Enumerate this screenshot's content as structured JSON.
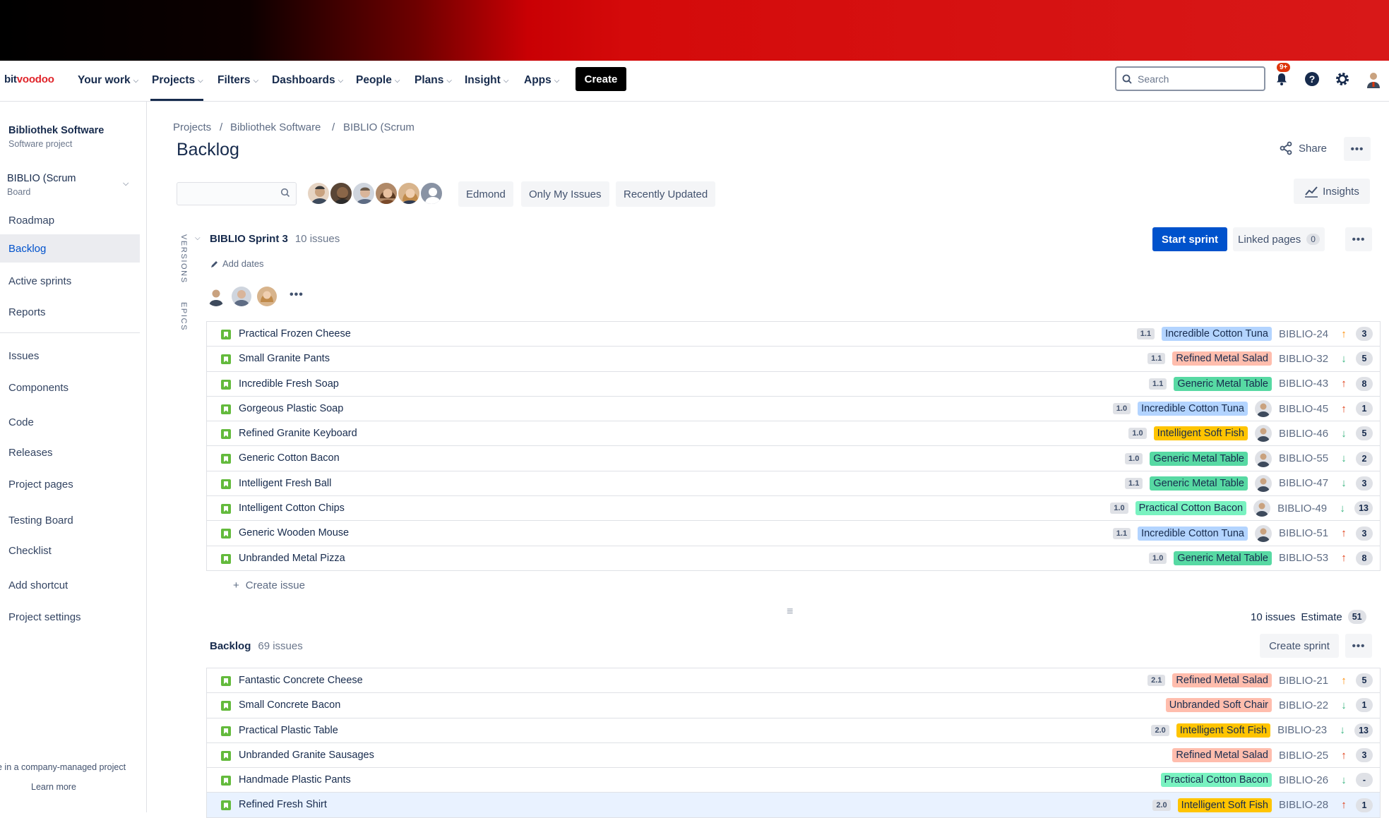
{
  "topnav": {
    "logo_a": "bit",
    "logo_b": "voodoo",
    "items": [
      {
        "label": "Your work"
      },
      {
        "label": "Projects"
      },
      {
        "label": "Filters"
      },
      {
        "label": "Dashboards"
      },
      {
        "label": "People"
      },
      {
        "label": "Plans"
      },
      {
        "label": "Insight"
      },
      {
        "label": "Apps"
      }
    ],
    "active": "Projects",
    "create": "Create",
    "search_placeholder": "Search",
    "notif_badge": "9+",
    "accent": "#0052cc"
  },
  "sidebar": {
    "project_name": "Bibliothek Software",
    "project_type": "Software project",
    "board_name": "BIBLIO (Scrum",
    "board_type": "Board",
    "items": [
      {
        "label": "Roadmap"
      },
      {
        "label": "Backlog"
      },
      {
        "label": "Active sprints"
      },
      {
        "label": "Reports"
      },
      {
        "label": "Issues"
      },
      {
        "label": "Components"
      },
      {
        "label": "Code"
      },
      {
        "label": "Releases"
      },
      {
        "label": "Project pages"
      },
      {
        "label": "Testing Board"
      },
      {
        "label": "Checklist"
      },
      {
        "label": "Add shortcut"
      },
      {
        "label": "Project settings"
      }
    ],
    "active": "Backlog",
    "footer_text": "e in a company-managed project",
    "footer_link": "Learn more"
  },
  "breadcrumb": [
    "Projects",
    "Bibliothek Software",
    "BIBLIO (Scrum"
  ],
  "page_title": "Backlog",
  "share_label": "Share",
  "filters": {
    "edmond": "Edmond",
    "only_my": "Only My Issues",
    "recent": "Recently Updated",
    "insights": "Insights"
  },
  "side_tabs": {
    "versions": "VERSIONS",
    "epics": "EPICS"
  },
  "sprint": {
    "name": "BIBLIO Sprint 3",
    "count": "10 issues",
    "add_dates": "Add dates",
    "start": "Start sprint",
    "linked": "Linked pages",
    "linked_count": "0",
    "issues": [
      {
        "summary": "Practical Frozen Cheese",
        "version": "1.1",
        "epic": "Incredible Cotton Tuna",
        "epic_color": "#b3d4ff",
        "key": "BIBLIO-24",
        "priority": "up-orange",
        "estimate": "3",
        "assignee": false
      },
      {
        "summary": "Small Granite Pants",
        "version": "1.1",
        "epic": "Refined Metal Salad",
        "epic_color": "#ffbdad",
        "key": "BIBLIO-32",
        "priority": "down",
        "estimate": "5",
        "assignee": false
      },
      {
        "summary": "Incredible Fresh Soap",
        "version": "1.1",
        "epic": "Generic Metal Table",
        "epic_color": "#57d9a3",
        "key": "BIBLIO-43",
        "priority": "up-red",
        "estimate": "8",
        "assignee": false
      },
      {
        "summary": "Gorgeous Plastic Soap",
        "version": "1.0",
        "epic": "Incredible Cotton Tuna",
        "epic_color": "#b3d4ff",
        "key": "BIBLIO-45",
        "priority": "up-red",
        "estimate": "1",
        "assignee": true
      },
      {
        "summary": "Refined Granite Keyboard",
        "version": "1.0",
        "epic": "Intelligent Soft Fish",
        "epic_color": "#ffc400",
        "key": "BIBLIO-46",
        "priority": "down",
        "estimate": "5",
        "assignee": true
      },
      {
        "summary": "Generic Cotton Bacon",
        "version": "1.0",
        "epic": "Generic Metal Table",
        "epic_color": "#57d9a3",
        "key": "BIBLIO-55",
        "priority": "down",
        "estimate": "2",
        "assignee": true
      },
      {
        "summary": "Intelligent Fresh Ball",
        "version": "1.1",
        "epic": "Generic Metal Table",
        "epic_color": "#57d9a3",
        "key": "BIBLIO-47",
        "priority": "down",
        "estimate": "3",
        "assignee": true
      },
      {
        "summary": "Intelligent Cotton Chips",
        "version": "1.0",
        "epic": "Practical Cotton Bacon",
        "epic_color": "#79f2c0",
        "key": "BIBLIO-49",
        "priority": "down",
        "estimate": "13",
        "assignee": true
      },
      {
        "summary": "Generic Wooden Mouse",
        "version": "1.1",
        "epic": "Incredible Cotton Tuna",
        "epic_color": "#b3d4ff",
        "key": "BIBLIO-51",
        "priority": "up-red",
        "estimate": "3",
        "assignee": true
      },
      {
        "summary": "Unbranded Metal Pizza",
        "version": "1.0",
        "epic": "Generic Metal Table",
        "epic_color": "#57d9a3",
        "key": "BIBLIO-53",
        "priority": "up-red",
        "estimate": "8",
        "assignee": false
      }
    ],
    "create_issue": "Create issue",
    "footer_count": "10 issues",
    "footer_estimate": "Estimate",
    "footer_total": "51"
  },
  "backlog": {
    "name": "Backlog",
    "count": "69 issues",
    "create_sprint": "Create sprint",
    "issues": [
      {
        "summary": "Fantastic Concrete Cheese",
        "version": "2.1",
        "epic": "Refined Metal Salad",
        "epic_color": "#ffbdad",
        "key": "BIBLIO-21",
        "priority": "up-orange",
        "estimate": "5"
      },
      {
        "summary": "Small Concrete Bacon",
        "version": "",
        "epic": "Unbranded Soft Chair",
        "epic_color": "#ffbdad",
        "key": "BIBLIO-22",
        "priority": "down",
        "estimate": "1"
      },
      {
        "summary": "Practical Plastic Table",
        "version": "2.0",
        "epic": "Intelligent Soft Fish",
        "epic_color": "#ffc400",
        "key": "BIBLIO-23",
        "priority": "down",
        "estimate": "13"
      },
      {
        "summary": "Unbranded Granite Sausages",
        "version": "",
        "epic": "Refined Metal Salad",
        "epic_color": "#ffbdad",
        "key": "BIBLIO-25",
        "priority": "up-red",
        "estimate": "3"
      },
      {
        "summary": "Handmade Plastic Pants",
        "version": "",
        "epic": "Practical Cotton Bacon",
        "epic_color": "#79f2c0",
        "key": "BIBLIO-26",
        "priority": "down",
        "estimate": "-"
      },
      {
        "summary": "Refined Fresh Shirt",
        "version": "2.0",
        "epic": "Intelligent Soft Fish",
        "epic_color": "#ffc400",
        "key": "BIBLIO-28",
        "priority": "up-red",
        "estimate": "1",
        "selected": true
      }
    ]
  }
}
